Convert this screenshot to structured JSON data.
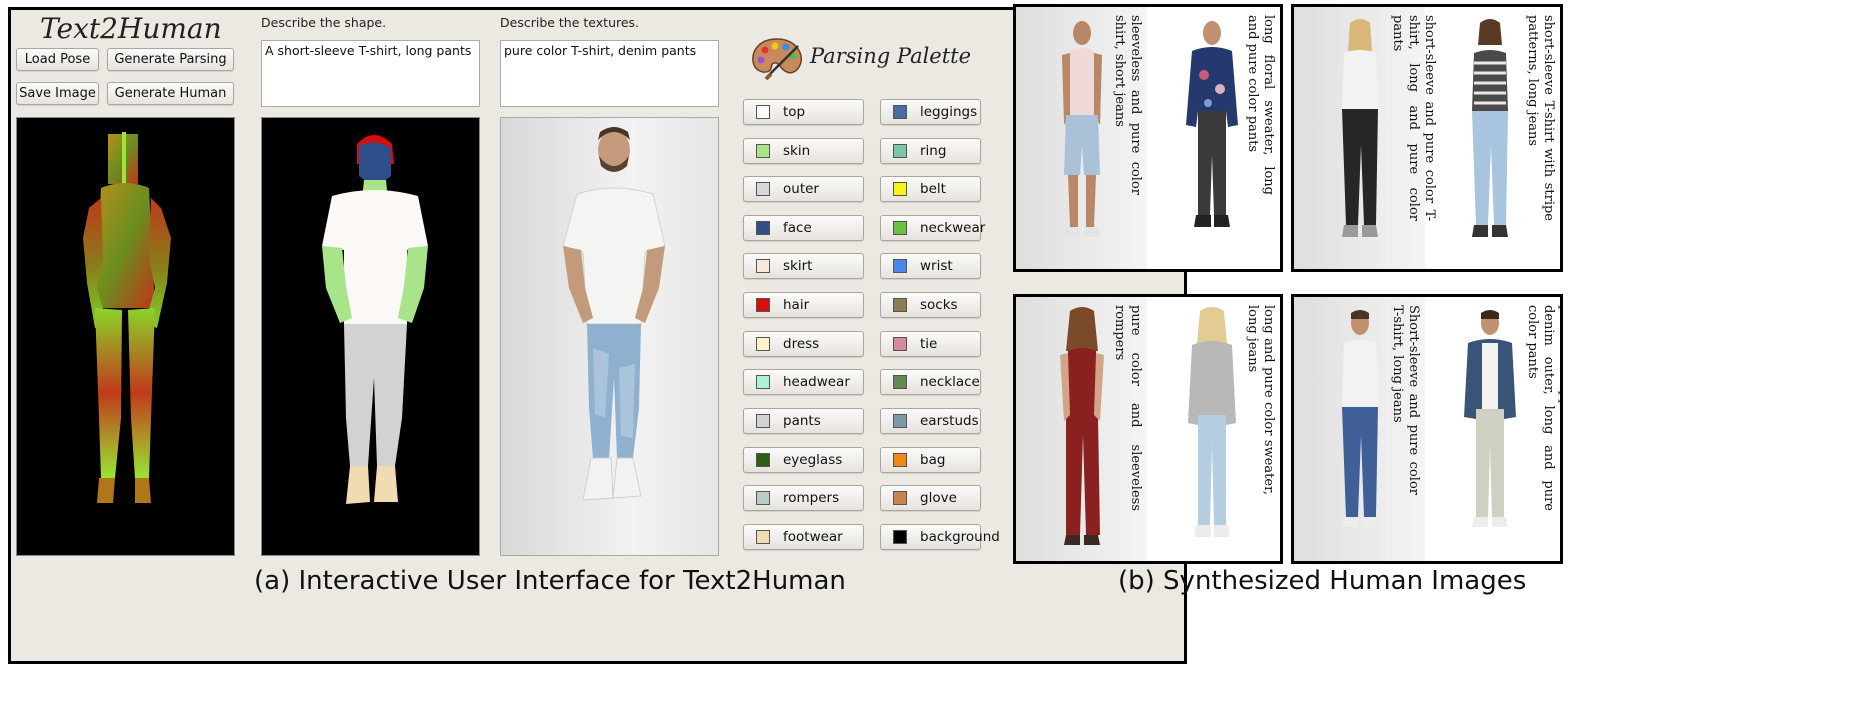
{
  "app": {
    "title": "Text2Human",
    "buttons": {
      "load_pose": "Load Pose",
      "generate_parsing": "Generate Parsing",
      "save_image": "Save Image",
      "generate_human": "Generate Human"
    },
    "shape_label": "Describe the shape.",
    "shape_value": "A short-sleeve T-shirt, long pants",
    "texture_label": "Describe the textures.",
    "texture_value": "pure color T-shirt, denim pants",
    "palette_title": "Parsing Palette",
    "palette_left": [
      {
        "label": "top",
        "color": "#fbfbfb"
      },
      {
        "label": "skin",
        "color": "#a8e48a"
      },
      {
        "label": "outer",
        "color": "#d7d7d7"
      },
      {
        "label": "face",
        "color": "#2e4f8a"
      },
      {
        "label": "skirt",
        "color": "#f7e9dc"
      },
      {
        "label": "hair",
        "color": "#d80d0d"
      },
      {
        "label": "dress",
        "color": "#fcf5c9"
      },
      {
        "label": "headwear",
        "color": "#a9f3d3"
      },
      {
        "label": "pants",
        "color": "#d2d2d2"
      },
      {
        "label": "eyeglass",
        "color": "#2f5d14"
      },
      {
        "label": "rompers",
        "color": "#b7cdc6"
      },
      {
        "label": "footwear",
        "color": "#f0dcb0"
      }
    ],
    "palette_right": [
      {
        "label": "leggings",
        "color": "#4b6c9e"
      },
      {
        "label": "ring",
        "color": "#7bc7a5"
      },
      {
        "label": "belt",
        "color": "#f6f21a"
      },
      {
        "label": "neckwear",
        "color": "#6cc23f"
      },
      {
        "label": "wrist",
        "color": "#4a86e8"
      },
      {
        "label": "socks",
        "color": "#8c7d52"
      },
      {
        "label": "tie",
        "color": "#d88a9a"
      },
      {
        "label": "necklace",
        "color": "#5e8a52"
      },
      {
        "label": "earstuds",
        "color": "#7d9aa6"
      },
      {
        "label": "bag",
        "color": "#ec8a12"
      },
      {
        "label": "glove",
        "color": "#c8844c"
      },
      {
        "label": "background",
        "color": "#000000"
      }
    ]
  },
  "caption_a": "(a) Interactive User Interface for Text2Human",
  "caption_b": "(b) Synthesized Human Images",
  "samples": [
    "sleeveless and pure color shirt, short jeans",
    "long floral sweater, long and pure color pants",
    "short-sleeve and pure color T-shirt, long and pure color pants",
    "short-sleeve T-shirt with stripe patterns, long jeans",
    "pure color and sleeveless rompers",
    "long and pure color sweater, long jeans",
    "Short-sleeve and pure color T-shirt, long jeans",
    "pure color upper clothes with denim outer, long and pure color pants"
  ]
}
